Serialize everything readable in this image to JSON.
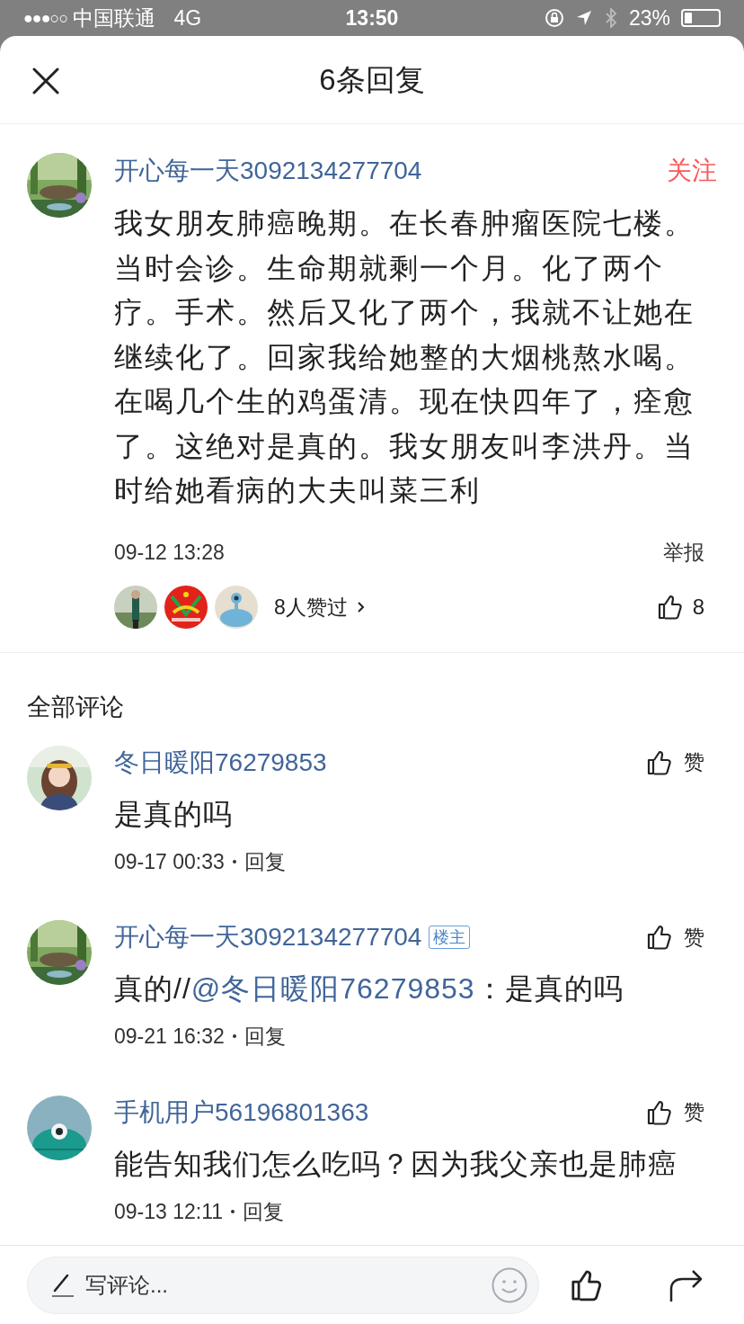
{
  "status_bar": {
    "signal": "●●●○○",
    "carrier": "中国联通",
    "network": "4G",
    "time": "13:50",
    "battery": "23%"
  },
  "header": {
    "title": "6条回复"
  },
  "post": {
    "author": "开心每一天3092134277704",
    "follow": "关注",
    "body": "我女朋友肺癌晚期。在长春肿瘤医院七楼。当时会诊。生命期就剩一个月。化了两个疗。手术。然后又化了两个，我就不让她在继续化了。回家我给她整的大烟桃熬水喝。在喝几个生的鸡蛋清。现在快四年了，痊愈了。这绝对是真的。我女朋友叫李洪丹。当时给她看病的大夫叫菜三利",
    "time": "09-12 13:28",
    "report": "举报",
    "likers_summary": "8人赞过",
    "like_count": "8"
  },
  "comments_heading": "全部评论",
  "comments": [
    {
      "author": "冬日暖阳76279853",
      "body": "是真的吗",
      "time": "09-17 00:33",
      "reply": "回复",
      "like": "赞"
    },
    {
      "author": "开心每一天3092134277704",
      "badge": "楼主",
      "body": "真的//",
      "mention": "@冬日暖阳76279853",
      "quote": "：是真的吗",
      "time": "09-21 16:32",
      "reply": "回复",
      "like": "赞"
    },
    {
      "author": "手机用户56196801363",
      "body": "能告知我们怎么吃吗？因为我父亲也是肺癌",
      "time": "09-13 12:11",
      "reply": "回复",
      "like": "赞"
    }
  ],
  "composer": {
    "placeholder": "写评论..."
  }
}
